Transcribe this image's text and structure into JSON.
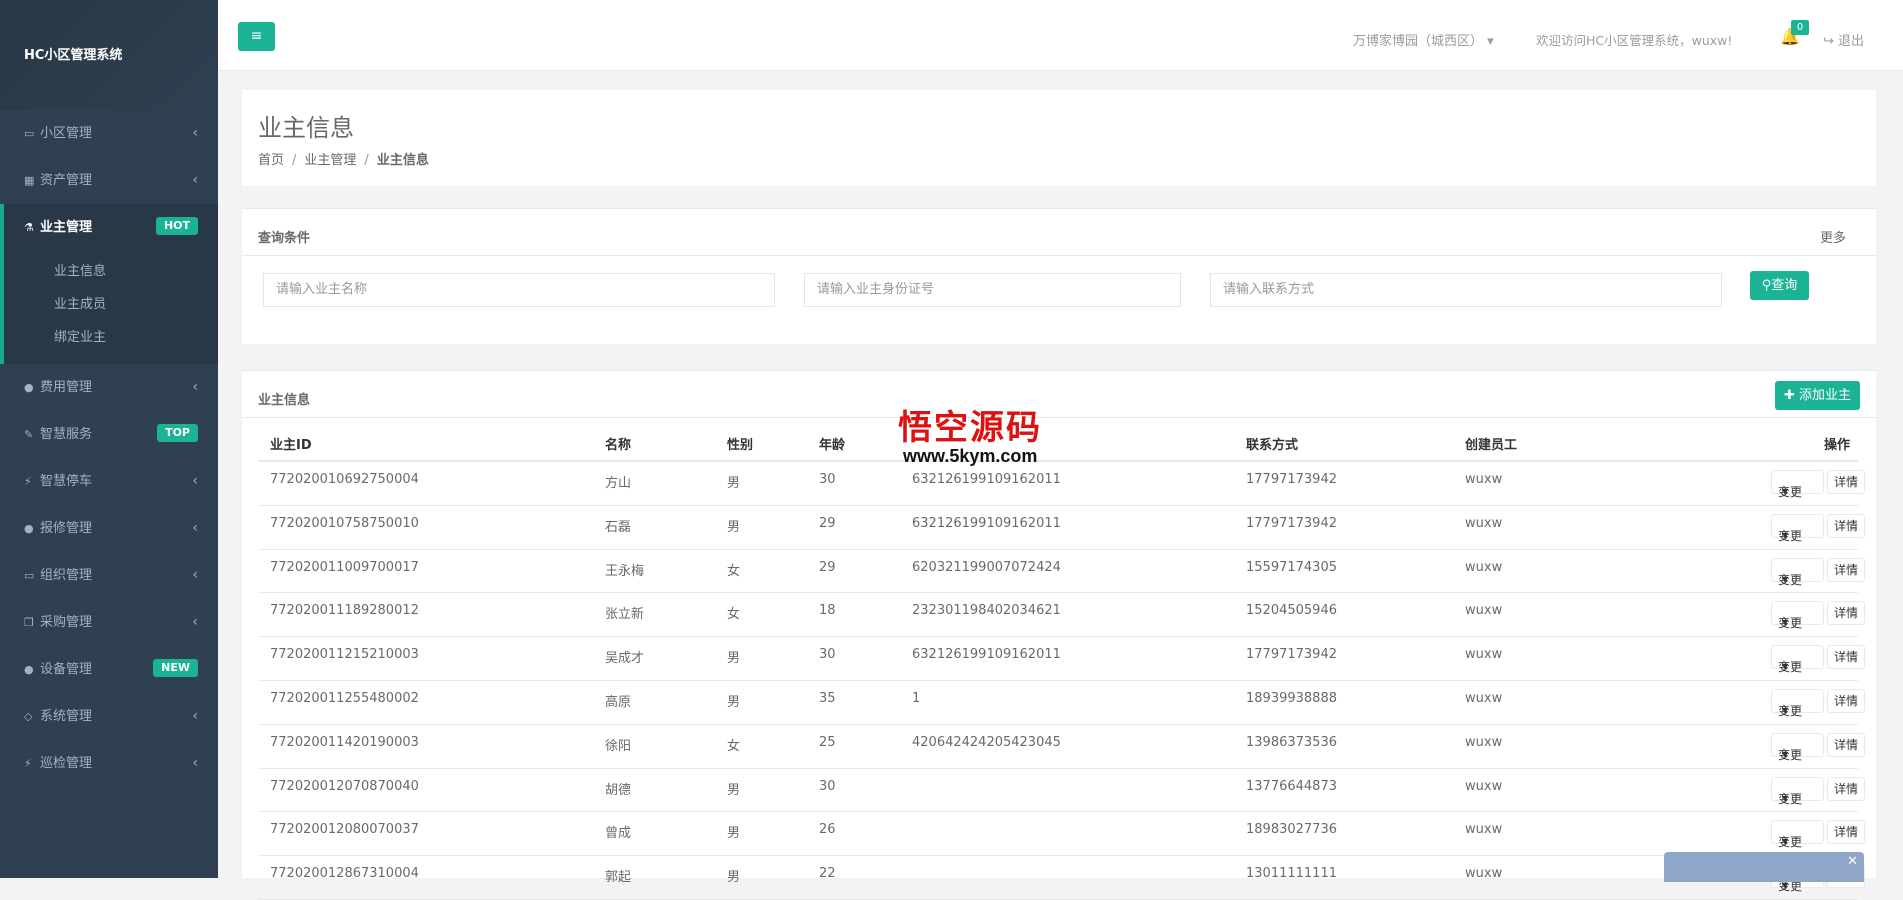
{
  "sidebar": {
    "logo": "HC小区管理系统",
    "items": [
      {
        "label": "小区管理",
        "icon": "laptop-icon",
        "arrow": "‹"
      },
      {
        "label": "资产管理",
        "icon": "grid-icon",
        "arrow": "‹"
      },
      {
        "label": "业主管理",
        "icon": "flask-icon",
        "badge": "HOT"
      },
      {
        "label": "费用管理",
        "icon": "globe-icon",
        "arrow": "‹"
      },
      {
        "label": "智慧服务",
        "icon": "edit-icon",
        "badge": "TOP"
      },
      {
        "label": "智慧停车",
        "icon": "bolt-icon",
        "arrow": "‹"
      },
      {
        "label": "报修管理",
        "icon": "globe-icon",
        "arrow": "‹"
      },
      {
        "label": "组织管理",
        "icon": "desktop-icon",
        "arrow": "‹"
      },
      {
        "label": "采购管理",
        "icon": "copy-icon",
        "arrow": "‹"
      },
      {
        "label": "设备管理",
        "icon": "globe-icon",
        "badge": "NEW"
      },
      {
        "label": "系统管理",
        "icon": "diamond-icon",
        "arrow": "‹"
      },
      {
        "label": "巡检管理",
        "icon": "bolt-icon",
        "arrow": "‹"
      }
    ],
    "subitems": [
      "业主信息",
      "业主成员",
      "绑定业主"
    ]
  },
  "topbar": {
    "menu_icon": "≡",
    "community": "万博家博园（城西区）",
    "community_caret": "▾",
    "welcome": "欢迎访问HC小区管理系统，wuxw!",
    "notifications": "0",
    "logout": "退出"
  },
  "heading": {
    "title": "业主信息",
    "crumbs": [
      "首页",
      "业主管理",
      "业主信息"
    ]
  },
  "query": {
    "title": "查询条件",
    "more": "更多",
    "name_placeholder": "请输入业主名称",
    "idcard_placeholder": "请输入业主身份证号",
    "phone_placeholder": "请输入联系方式",
    "button": "查询"
  },
  "table": {
    "title": "业主信息",
    "add_button": "添加业主",
    "headers": {
      "id": "业主ID",
      "name": "名称",
      "sex": "性别",
      "age": "年龄",
      "idcard": "",
      "tel": "联系方式",
      "staff": "创建员工",
      "op": "操作"
    },
    "change_label": "变更",
    "detail_label": "详情",
    "rows": [
      {
        "id": "772020010692750004",
        "name": "方山",
        "sex": "男",
        "age": "30",
        "idcard": "632126199109162011",
        "tel": "17797173942",
        "staff": "wuxw"
      },
      {
        "id": "772020010758750010",
        "name": "石磊",
        "sex": "男",
        "age": "29",
        "idcard": "632126199109162011",
        "tel": "17797173942",
        "staff": "wuxw"
      },
      {
        "id": "772020011009700017",
        "name": "王永梅",
        "sex": "女",
        "age": "29",
        "idcard": "620321199007072424",
        "tel": "15597174305",
        "staff": "wuxw"
      },
      {
        "id": "772020011189280012",
        "name": "张立新",
        "sex": "女",
        "age": "18",
        "idcard": "232301198402034621",
        "tel": "15204505946",
        "staff": "wuxw"
      },
      {
        "id": "772020011215210003",
        "name": "吴成才",
        "sex": "男",
        "age": "30",
        "idcard": "632126199109162011",
        "tel": "17797173942",
        "staff": "wuxw"
      },
      {
        "id": "772020011255480002",
        "name": "高原",
        "sex": "男",
        "age": "35",
        "idcard": "1",
        "tel": "18939938888",
        "staff": "wuxw"
      },
      {
        "id": "772020011420190003",
        "name": "徐阳",
        "sex": "女",
        "age": "25",
        "idcard": "420642424205423045",
        "tel": "13986373536",
        "staff": "wuxw"
      },
      {
        "id": "772020012070870040",
        "name": "胡德",
        "sex": "男",
        "age": "30",
        "idcard": "",
        "tel": "13776644873",
        "staff": "wuxw"
      },
      {
        "id": "772020012080070037",
        "name": "曾成",
        "sex": "男",
        "age": "26",
        "idcard": "",
        "tel": "18983027736",
        "staff": "wuxw"
      },
      {
        "id": "772020012867310004",
        "name": "郭起",
        "sex": "男",
        "age": "22",
        "idcard": "",
        "tel": "13011111111",
        "staff": "wuxw"
      }
    ]
  },
  "float_tab": {
    "close": "✕"
  },
  "watermark": {
    "line1": "悟空源码",
    "line2": "www.5kym.com"
  }
}
